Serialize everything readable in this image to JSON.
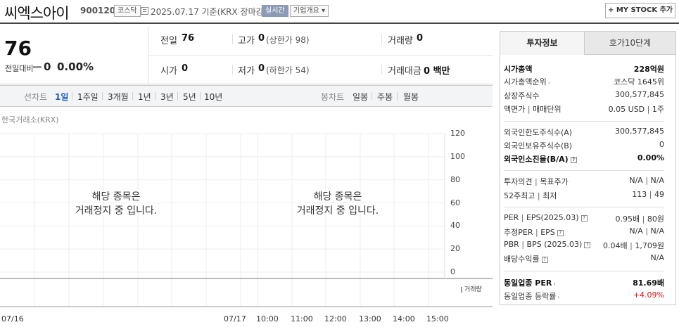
{
  "header": {
    "name": "씨엑스아이",
    "code": "900120",
    "market": "코스닥",
    "date_text": "2025.07.17  기준(KRX 장마감)",
    "realtime": "실시간",
    "overview": "기업개요",
    "overview_arrow": "▾",
    "mystock": "+ MY STOCK 추가"
  },
  "price": {
    "current": "76",
    "change_label": "전일대비",
    "change": "0",
    "change_rate": "0.00%"
  },
  "stats": {
    "prev_label": "전일",
    "prev": "76",
    "high_label": "고가",
    "high": "0",
    "upper": "(상한가 98)",
    "volume_label": "거래량",
    "volume": "0",
    "open_label": "시가",
    "open": "0",
    "low_label": "저가",
    "low": "0",
    "lower": "(하한가 54)",
    "amount_label": "거래대금",
    "amount": "0 백만"
  },
  "chart_tabs": {
    "line_label": "선차트",
    "periods": [
      "1일",
      "1주일",
      "3개월",
      "1년",
      "3년",
      "5년",
      "10년"
    ],
    "candle_label": "봉차트",
    "candles": [
      "일봉",
      "주봉",
      "월봉"
    ]
  },
  "chart": {
    "source": "한국거래소(KRX)",
    "nodata_line1": "해당 종목은",
    "nodata_line2": "거래정지 중 입니다.",
    "volume_legend": "거래량"
  },
  "chart_data": {
    "type": "line",
    "yticks": [
      0,
      20,
      40,
      60,
      80,
      100,
      120
    ],
    "xticks": [
      "07/16",
      "07/17",
      "10:00",
      "11:00",
      "12:00",
      "13:00",
      "14:00",
      "15:00"
    ],
    "ylim": [
      0,
      120
    ],
    "series": [],
    "grid": true
  },
  "panel": {
    "tab_info": "투자정보",
    "tab_orderbook": "호가10단계",
    "mcap_label": "시가총액",
    "mcap": "228억원",
    "mcap_rank_label": "시가총액순위",
    "mcap_rank": "코스닥 1645위",
    "shares_label": "상장주식수",
    "shares": "300,577,845",
    "par_label": "액면가",
    "unit_label": "매매단위",
    "par": "0.05 USD",
    "unit": "1주",
    "foreign_limit_label": "외국인한도주식수(A)",
    "foreign_limit": "300,577,845",
    "foreign_hold_label": "외국인보유주식수(B)",
    "foreign_hold": "0",
    "foreign_ratio_label": "외국인소진율(B/A)",
    "foreign_ratio": "0.00%",
    "opinion_label": "투자의견",
    "target_label": "목표주가",
    "opinion": "N/A",
    "target": "N/A",
    "w52_high_label": "52주최고",
    "w52_low_label": "최저",
    "w52_high": "113",
    "w52_low": "49",
    "per_label": "PER",
    "eps_label": "EPS(2025.03)",
    "per": "0.95배",
    "eps": "80원",
    "est_per_label": "추정PER",
    "est_eps_label": "EPS",
    "est_per": "N/A",
    "est_eps": "N/A",
    "pbr_label": "PBR",
    "bps_label": "BPS (2025.03)",
    "pbr": "0.04배",
    "bps": "1,709원",
    "div_label": "배당수익률",
    "div": "N/A",
    "ind_per_label": "동일업종 PER",
    "ind_per": "81.69배",
    "ind_rate_label": "동일업종 등락률",
    "ind_rate": "+4.09%",
    "q": "?",
    "arrow": "›"
  }
}
